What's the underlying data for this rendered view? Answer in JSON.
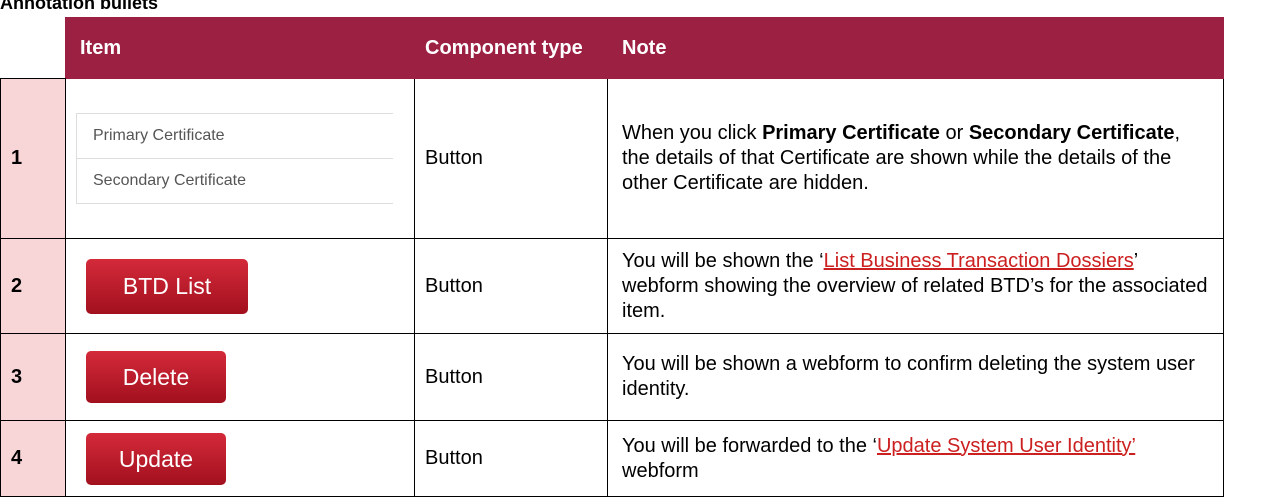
{
  "title": "Annotation bullets",
  "headers": {
    "item": "Item",
    "component_type": "Component type",
    "note": "Note"
  },
  "rows": [
    {
      "num": "1",
      "cert_items": [
        "Primary Certificate",
        "Secondary Certificate"
      ],
      "type": "Button",
      "note": {
        "p1": "When you click ",
        "b1": "Primary Certificate",
        "p2": " or ",
        "b2": "Secondary Certificate",
        "p3": ", the details of that Certificate are shown while the details of the other Certificate are hidden."
      }
    },
    {
      "num": "2",
      "button_label": "BTD List",
      "type": "Button",
      "note": {
        "p1": "You will be shown the ‘",
        "link": "List Business Transaction Dossiers",
        "p2": "’ webform showing the overview of related BTD’s for the associated item."
      }
    },
    {
      "num": "3",
      "button_label": "Delete",
      "type": "Button",
      "note": {
        "p1": "You will be shown a webform to confirm deleting the system user identity."
      }
    },
    {
      "num": "4",
      "button_label": "Update",
      "type": "Button",
      "note": {
        "p1": "You will be forwarded to the ‘",
        "link": "Update System User Identity’",
        "p2": " webform"
      }
    }
  ],
  "colors": {
    "header_bg": "#9b2042",
    "number_cell_bg": "#f8d6d8",
    "button_red": "#b8182a",
    "link": "#cc1f1f"
  }
}
